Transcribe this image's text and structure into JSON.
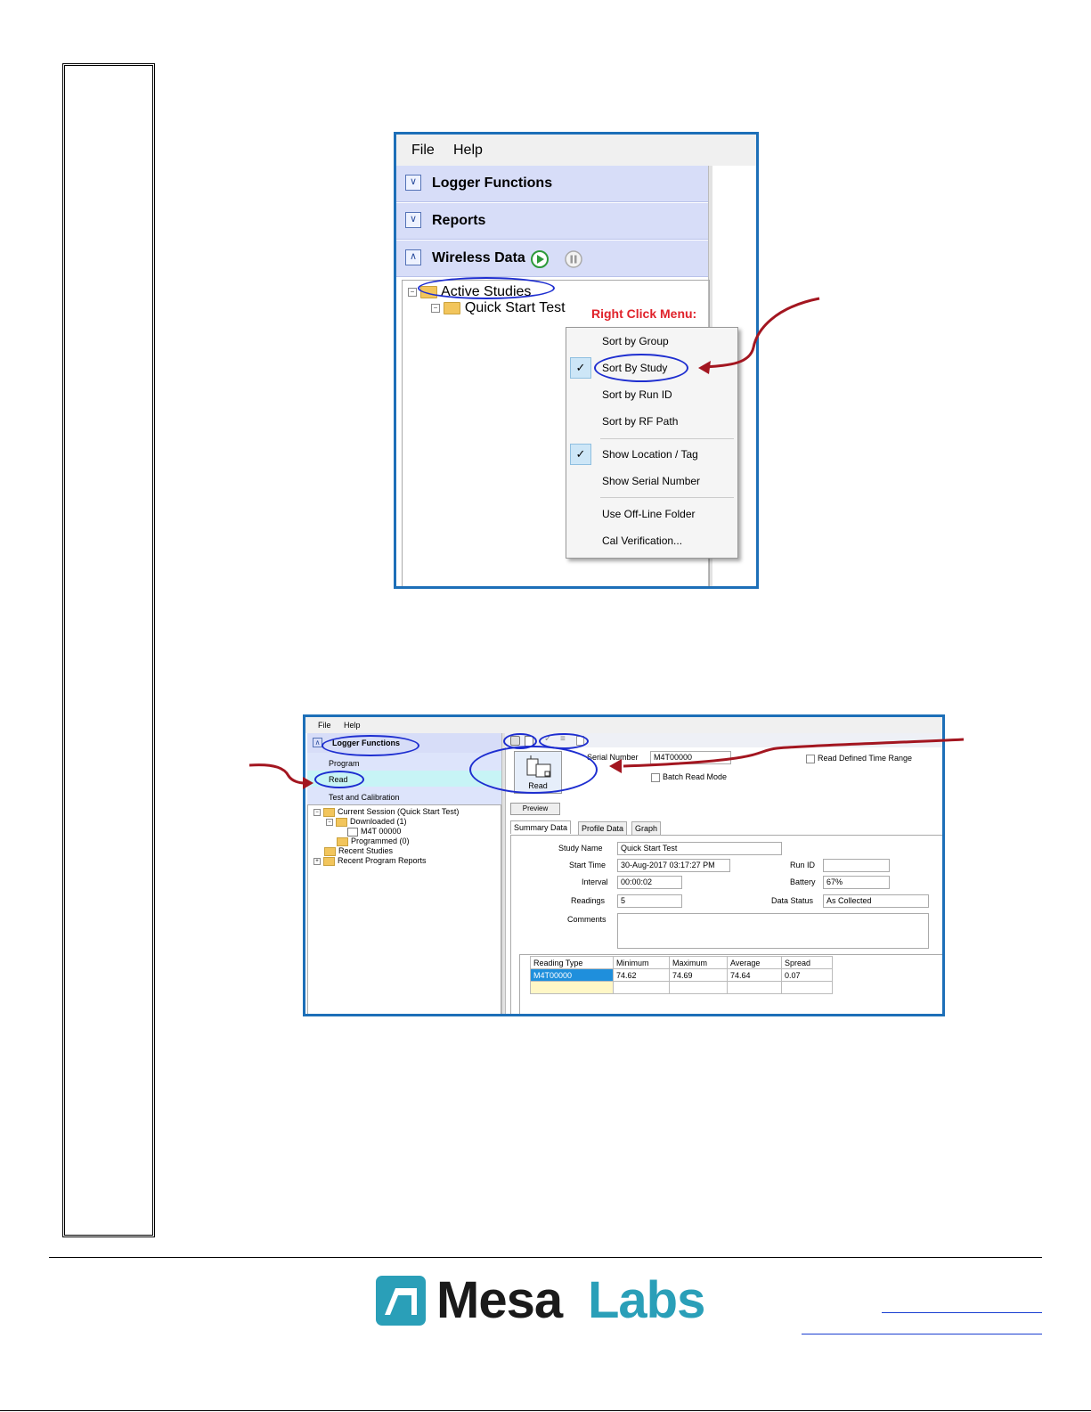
{
  "screenshot1": {
    "menu": [
      "File",
      "Help"
    ],
    "panels": [
      {
        "title": "Logger Functions",
        "state": "collapsed"
      },
      {
        "title": "Reports",
        "state": "collapsed"
      },
      {
        "title": "Wireless Data",
        "state": "expanded"
      }
    ],
    "tree": {
      "root": "Active Studies",
      "child": "Quick Start Test"
    },
    "annotation": "Right Click Menu:",
    "context_menu": [
      {
        "label": "Sort by Group",
        "checked": false
      },
      {
        "label": "Sort By Study",
        "checked": true
      },
      {
        "label": "Sort by Run ID",
        "checked": false
      },
      {
        "label": "Sort by RF Path",
        "checked": false
      },
      {
        "label": "Show Location / Tag",
        "checked": true
      },
      {
        "label": "Show Serial Number",
        "checked": false
      },
      {
        "label": "Use Off-Line Folder",
        "checked": false
      },
      {
        "label": "Cal Verification...",
        "checked": false
      }
    ]
  },
  "screenshot2": {
    "menu": [
      "File",
      "Help"
    ],
    "panel_title": "Logger Functions",
    "functions": [
      "Program",
      "Read",
      "Test and Calibration"
    ],
    "tree": {
      "current_session": "Current Session (Quick Start Test)",
      "downloaded": "Downloaded (1)",
      "device": "M4T 00000",
      "programmed": "Programmed (0)",
      "recent_studies": "Recent Studies",
      "recent_reports": "Recent Program Reports"
    },
    "read_button": "Read",
    "serial_label": "Serial Number",
    "serial_value": "M4T00000",
    "batch_read": "Batch Read Mode",
    "read_defined": "Read Defined Time Range",
    "preview": "Preview",
    "tabs": [
      "Summary Data",
      "Profile Data",
      "Graph"
    ],
    "summary": {
      "study_name_label": "Study Name",
      "study_name": "Quick Start Test",
      "start_time_label": "Start Time",
      "start_time": "30-Aug-2017 03:17:27 PM",
      "interval_label": "Interval",
      "interval": "00:00:02",
      "readings_label": "Readings",
      "readings": "5",
      "comments_label": "Comments",
      "run_id_label": "Run ID",
      "run_id": "",
      "battery_label": "Battery",
      "battery": "67%",
      "data_status_label": "Data Status",
      "data_status": "As Collected"
    },
    "table": {
      "headers": [
        "Reading Type",
        "Minimum",
        "Maximum",
        "Average",
        "Spread"
      ],
      "rows": [
        [
          "M4T00000",
          "74.62",
          "74.69",
          "74.64",
          "0.07"
        ]
      ]
    }
  },
  "footer": {
    "logo_text_1": "Mesa",
    "logo_text_2": "Labs",
    "colors": {
      "mesa": "#1a1a1a",
      "labs": "#2a9fb8",
      "mark": "#2a9fb8"
    }
  },
  "colors": {
    "frame": "#1d6fb8",
    "annotation_ring": "#1e2ed0",
    "arrow": "#a31620",
    "annotation_text": "#e0232b"
  }
}
